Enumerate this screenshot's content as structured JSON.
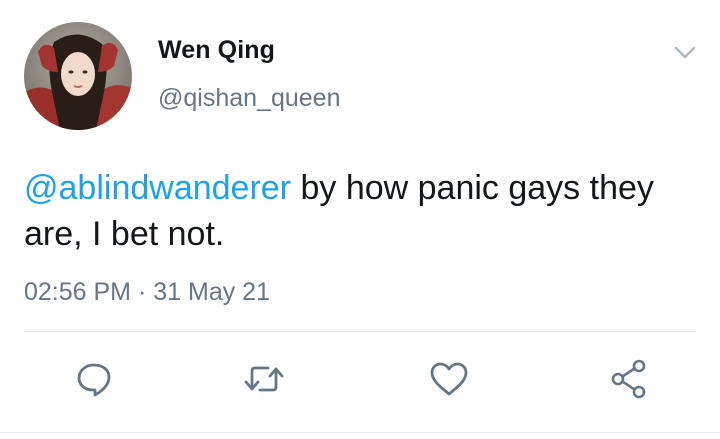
{
  "author": {
    "display_name": "Wen Qing",
    "handle": "@qishan_queen"
  },
  "tweet": {
    "mention": "@ablindwanderer",
    "text": " by how panic gays they are, I bet not.",
    "time": "02:56 PM",
    "separator": " · ",
    "date": "31 May 21"
  },
  "icons": {
    "menu": "chevron-down-icon",
    "reply": "reply-icon",
    "retweet": "retweet-icon",
    "like": "heart-icon",
    "share": "share-icon"
  },
  "colors": {
    "text": "#14171a",
    "secondary": "#657786",
    "link": "#1da1f2",
    "icon": "#657786",
    "divider": "#e1e8ed"
  }
}
